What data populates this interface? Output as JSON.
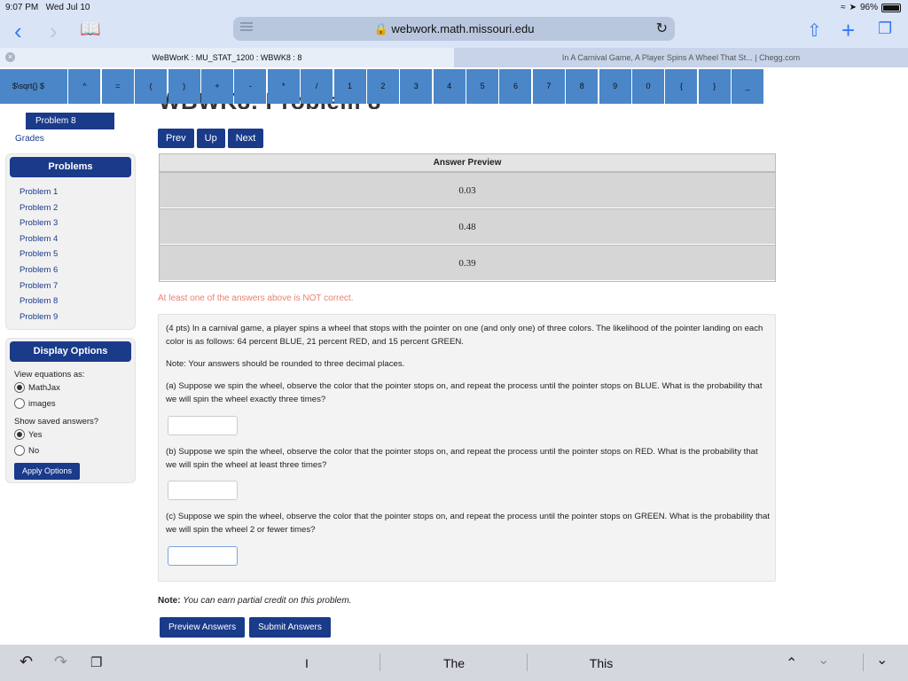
{
  "status": {
    "time": "9:07 PM",
    "date": "Wed Jul 10",
    "battery": "96%"
  },
  "browser": {
    "url": "webwork.math.missouri.edu",
    "tabs": [
      {
        "title": "WeBWorK : MU_STAT_1200 : WBWK8 : 8"
      },
      {
        "title": "In A Carnival Game, A Player Spins A Wheel That St... | Chegg.com"
      }
    ]
  },
  "palette": {
    "keys": [
      "$\\sqrt{} $",
      "^",
      "=",
      "(",
      ")",
      "+",
      "-",
      "*",
      "/",
      "1",
      "2",
      "3",
      "4",
      "5",
      "6",
      "7",
      "8",
      "9",
      "0",
      "{",
      "}",
      "_"
    ]
  },
  "sidebar": {
    "current_problem": "Problem 8",
    "grades": "Grades",
    "problems_header": "Problems",
    "problems": [
      "Problem 1",
      "Problem 2",
      "Problem 3",
      "Problem 4",
      "Problem 5",
      "Problem 6",
      "Problem 7",
      "Problem 8",
      "Problem 9"
    ],
    "display_header": "Display Options",
    "view_label": "View equations as:",
    "view_opt1": "MathJax",
    "view_opt2": "images",
    "saved_label": "Show saved answers?",
    "saved_yes": "Yes",
    "saved_no": "No",
    "apply": "Apply Options"
  },
  "main": {
    "title": "WBWK8: Problem 8",
    "nav": {
      "prev": "Prev",
      "up": "Up",
      "next": "Next"
    },
    "answer_preview_header": "Answer Preview",
    "answers": [
      "0.03",
      "0.48",
      "0.39"
    ],
    "warning": "At least one of the answers above is NOT correct.",
    "problem": {
      "intro": "(4 pts) In a carnival game, a player spins a wheel that stops with the pointer on one (and only one) of three colors. The likelihood of the pointer landing on each color is as follows: 64 percent BLUE, 21 percent RED, and 15 percent GREEN.",
      "note": "Note: Your answers should be rounded to three decimal places.",
      "part_a": "(a) Suppose we spin the wheel, observe the color that the pointer stops on, and repeat the process until the pointer stops on BLUE. What is the probability that we will spin the wheel exactly three times?",
      "part_b": "(b) Suppose we spin the wheel, observe the color that the pointer stops on, and repeat the process until the pointer stops on RED. What is the probability that we will spin the wheel at least three times?",
      "part_c": "(c) Suppose we spin the wheel, observe the color that the pointer stops on, and repeat the process until the pointer stops on GREEN. What is the probability that we will spin the wheel 2 or fewer times?"
    },
    "partial_note_label": "Note:",
    "partial_note_text": "You can earn partial credit on this problem.",
    "preview_btn": "Preview Answers",
    "submit_btn": "Submit Answers"
  },
  "keyboard": {
    "suggestions": [
      "I",
      "The",
      "This"
    ]
  }
}
